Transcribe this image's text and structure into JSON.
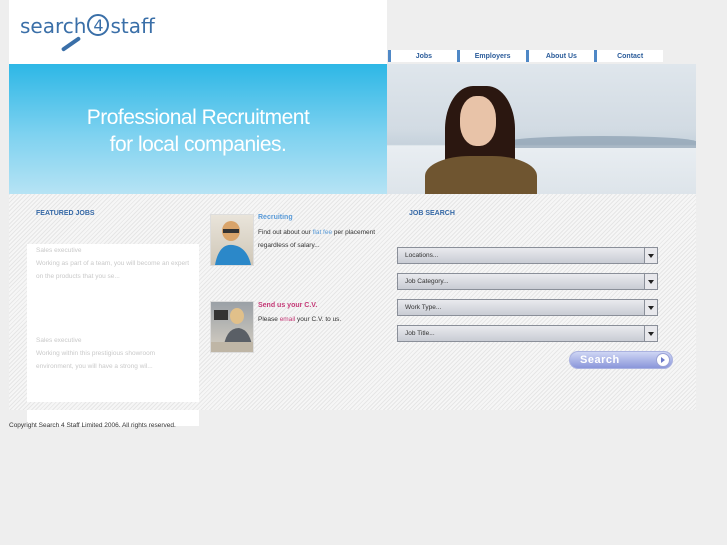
{
  "logo": {
    "prefix": "search",
    "digit": "4",
    "suffix": "staff"
  },
  "nav": [
    {
      "label": "Jobs"
    },
    {
      "label": "Employers"
    },
    {
      "label": "About Us"
    },
    {
      "label": "Contact"
    }
  ],
  "banner": {
    "line1": "Professional Recruitment",
    "line2": "for local companies."
  },
  "featured": {
    "title": "FEATURED JOBS",
    "jobs": [
      {
        "title": "Sales executive",
        "line1": "Working as part of a team, you will become an expert",
        "line2": "on the products that you se..."
      },
      {
        "title": "Sales executive",
        "line1": "Working within this prestigious showroom",
        "line2": "environment, you will have a strong wil..."
      }
    ]
  },
  "recruiting": {
    "title": "Recruiting",
    "text_pre": "Find out about our ",
    "highlight": "flat fee",
    "text_post": " per placement",
    "line2": "regardless of salary..."
  },
  "cv": {
    "title": "Send us your C.V.",
    "text_pre": "Please ",
    "link": "email",
    "text_post": " your C.V. to us."
  },
  "job_search": {
    "title": "JOB SEARCH",
    "locations": "Locations...",
    "category": "Job Category...",
    "work_type": "Work Type...",
    "job_title": "Job Title...",
    "search_label": "Search"
  },
  "footer": {
    "copyright": "Copyright Search 4 Staff Limited 2006. All rights reserved."
  },
  "colors": {
    "accent": "#3568a6",
    "banner": "#2db7e6",
    "pink": "#c53a77"
  }
}
